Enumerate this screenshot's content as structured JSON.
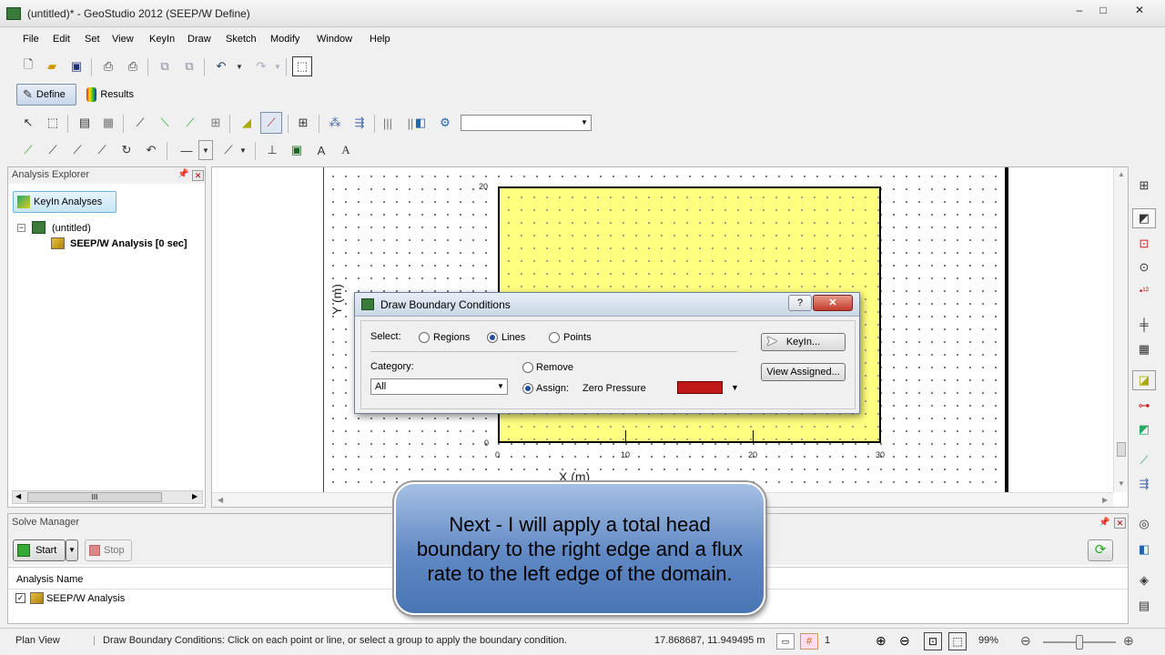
{
  "window": {
    "title": "(untitled)* - GeoStudio 2012 (SEEP/W Define)",
    "controls": [
      "–",
      "□",
      "✕"
    ]
  },
  "menu": [
    "File",
    "Edit",
    "Set",
    "View",
    "KeyIn",
    "Draw",
    "Sketch",
    "Modify",
    "Window",
    "Help"
  ],
  "modes": {
    "define": "Define",
    "results": "Results"
  },
  "explorer": {
    "title": "Analysis Explorer",
    "keyin_button": "KeyIn Analyses",
    "tree_root": "(untitled)",
    "tree_child": "SEEP/W Analysis [0 sec]",
    "scroll_grip": "III"
  },
  "canvas": {
    "y_ticks": [
      "20",
      "0"
    ],
    "x_ticks": [
      "0",
      "10",
      "20",
      "30"
    ],
    "x_axis_label": "X (m)",
    "y_axis_label": "Y (m)",
    "region_color": "#ffff80"
  },
  "dialog": {
    "title": "Draw Boundary Conditions",
    "select_label": "Select:",
    "select_options": [
      "Regions",
      "Lines",
      "Points"
    ],
    "selected": "Lines",
    "category_label": "Category:",
    "category_value": "All",
    "remove_label": "Remove",
    "assign_label": "Assign:",
    "assign_value": "Zero Pressure",
    "assign_color": "#c01818",
    "keyin_button": "KeyIn...",
    "view_assigned_button": "View Assigned..."
  },
  "solve_manager": {
    "title": "Solve Manager",
    "start": "Start",
    "stop": "Stop",
    "column": "Analysis Name",
    "rows": [
      "SEEP/W Analysis"
    ]
  },
  "callout": {
    "text": "Next - I will apply a total head boundary to the right edge and a flux rate to the left edge of the domain."
  },
  "status": {
    "view": "Plan View",
    "message": "Draw Boundary Conditions:  Click on each point or line, or select a group to apply the boundary condition.",
    "coords": "17.868687, 11.949495 m",
    "grid_value": "1",
    "zoom": "99%"
  }
}
